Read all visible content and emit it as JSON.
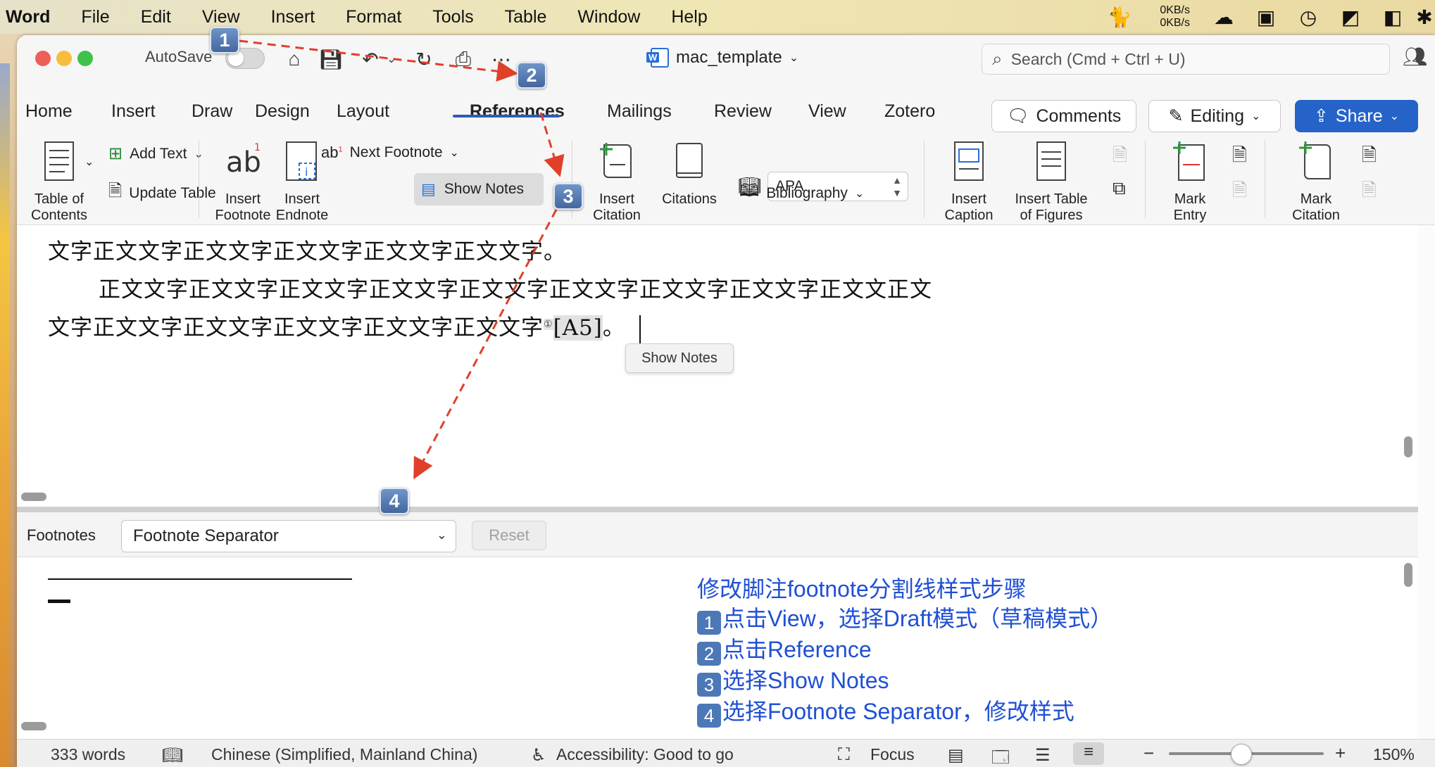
{
  "menubar": {
    "app": "Word",
    "items": [
      "File",
      "Edit",
      "View",
      "Insert",
      "Format",
      "Tools",
      "Table",
      "Window",
      "Help"
    ],
    "net_up": "0KB/s",
    "net_down": "0KB/s"
  },
  "titlebar": {
    "autosave_label": "AutoSave",
    "doc_title": "mac_template",
    "search_placeholder": "Search (Cmd + Ctrl + U)"
  },
  "tabs": {
    "items": [
      "Home",
      "Insert",
      "Draw",
      "Design",
      "Layout",
      "References",
      "Mailings",
      "Review",
      "View",
      "Zotero"
    ],
    "active": "References",
    "comments_label": "Comments",
    "editing_label": "Editing",
    "share_label": "Share"
  },
  "ribbon": {
    "toc_line1": "Table of",
    "toc_line2": "Contents",
    "add_text": "Add Text",
    "update_table": "Update Table",
    "insert_footnote_line1": "Insert",
    "insert_footnote_line2": "Footnote",
    "insert_endnote_line1": "Insert",
    "insert_endnote_line2": "Endnote",
    "next_footnote": "Next Footnote",
    "show_notes": "Show Notes",
    "insert_citation_line1": "Insert",
    "insert_citation_line2": "Citation",
    "citations": "Citations",
    "style_value": "APA",
    "bibliography": "Bibliography",
    "insert_caption_line1": "Insert",
    "insert_caption_line2": "Caption",
    "insert_tof_line1": "Insert Table",
    "insert_tof_line2": "of Figures",
    "mark_entry_line1": "Mark",
    "mark_entry_line2": "Entry",
    "mark_citation_line1": "Mark",
    "mark_citation_line2": "Citation"
  },
  "document": {
    "line1": "文字正文文字正文文字正文文字正文文字正文文字。",
    "line2": "正文文字正文文字正文文字正文文字正文文字正文文字正文文字正文文字正文文正文",
    "line3": "文字正文文字正文文字正文文字正文文字正文文字",
    "footnote_mark": "①",
    "citation": "[A5]",
    "line3_end": "。",
    "tooltip": "Show Notes"
  },
  "footnotes": {
    "label": "Footnotes",
    "selected": "Footnote Separator",
    "reset": "Reset"
  },
  "instructions": {
    "title": "修改脚注footnote分割线样式步骤",
    "steps": [
      {
        "num": "1",
        "text": "点击View，选择Draft模式（草稿模式）"
      },
      {
        "num": "2",
        "text": "点击Reference"
      },
      {
        "num": "3",
        "text": "选择Show Notes"
      },
      {
        "num": "4",
        "text": "选择Footnote Separator，修改样式"
      }
    ]
  },
  "badges": [
    "1",
    "2",
    "3",
    "4"
  ],
  "statusbar": {
    "words": "333 words",
    "language": "Chinese (Simplified, Mainland China)",
    "accessibility": "Accessibility: Good to go",
    "focus": "Focus",
    "zoom": "150%"
  },
  "colors": {
    "accent": "#2563c9",
    "instruction_text": "#1f4fd4",
    "badge": "#4c78b8",
    "arrow": "#e0402a"
  }
}
